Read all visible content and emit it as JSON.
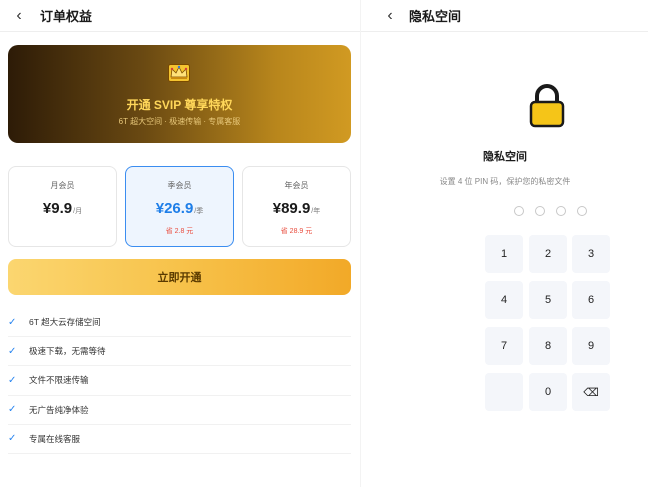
{
  "left": {
    "title": "订单权益",
    "banner": {
      "title": "开通 SVIP 尊享特权",
      "subtitle": "6T 超大空间 · 极速传输 · 专属客服"
    },
    "plans": [
      {
        "name": "月会员",
        "price": "¥9.9",
        "unit": "/月",
        "save": ""
      },
      {
        "name": "季会员",
        "price": "¥26.9",
        "unit": "/季",
        "save": "省 2.8 元"
      },
      {
        "name": "年会员",
        "price": "¥89.9",
        "unit": "/年",
        "save": "省 28.9 元"
      }
    ],
    "cta_label": "立即开通",
    "benefits": [
      "6T 超大云存储空间",
      "极速下载，无需等待",
      "文件不限速传输",
      "无广告纯净体验",
      "专属在线客服"
    ]
  },
  "right": {
    "title": "隐私空间",
    "heading": "隐私空间",
    "subtitle": "设置 4 位 PIN 码，保护您的私密文件",
    "keys": [
      "1",
      "2",
      "3",
      "4",
      "5",
      "6",
      "7",
      "8",
      "9",
      "",
      "0",
      "⌫"
    ]
  },
  "colors": {
    "accent_blue": "#1e7ee8",
    "gold": "#f2a928",
    "save_red": "#e94b3c"
  },
  "icons": {
    "back": "chevron-left-icon",
    "crown": "crown-icon",
    "check": "check-icon",
    "lock": "lock-icon",
    "backspace": "backspace-icon"
  }
}
